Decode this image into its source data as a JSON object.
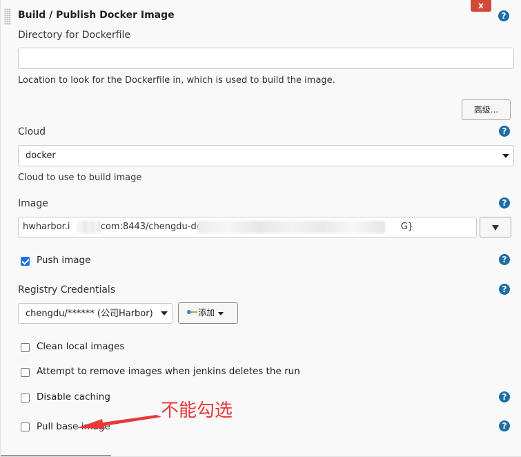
{
  "section": {
    "title": "Build / Publish Docker Image",
    "close_label": "x",
    "help_glyph": "?"
  },
  "dockerfile": {
    "label": "Directory for Dockerfile",
    "value": "",
    "description": "Location to look for the Dockerfile in, which is used to build the image."
  },
  "advanced_button": "高级...",
  "cloud": {
    "label": "Cloud",
    "selected": "docker",
    "description": "Cloud to use to build image"
  },
  "image": {
    "label": "Image",
    "value_prefix": "hwharbor.i",
    "value_middle": "com:8443/chengdu-dev",
    "value_suffix": "G}"
  },
  "push_image": {
    "label": "Push image",
    "checked": true
  },
  "registry": {
    "label": "Registry Credentials",
    "selected": "chengdu/****** (公司Harbor)",
    "add_button": "添加"
  },
  "options": {
    "clean_local": "Clean local images",
    "remove_on_delete": "Attempt to remove images when jenkins deletes the run",
    "disable_caching": "Disable caching",
    "pull_base": "Pull base image"
  },
  "annotation": {
    "text": "不能勾选",
    "color": "#e8383a"
  },
  "colors": {
    "help": "#1d6ea8",
    "close": "#d24939",
    "checkbox_checked": "#1a73e8"
  },
  "icons": {
    "add": "key-icon",
    "dropdown": "caret-down-icon"
  }
}
